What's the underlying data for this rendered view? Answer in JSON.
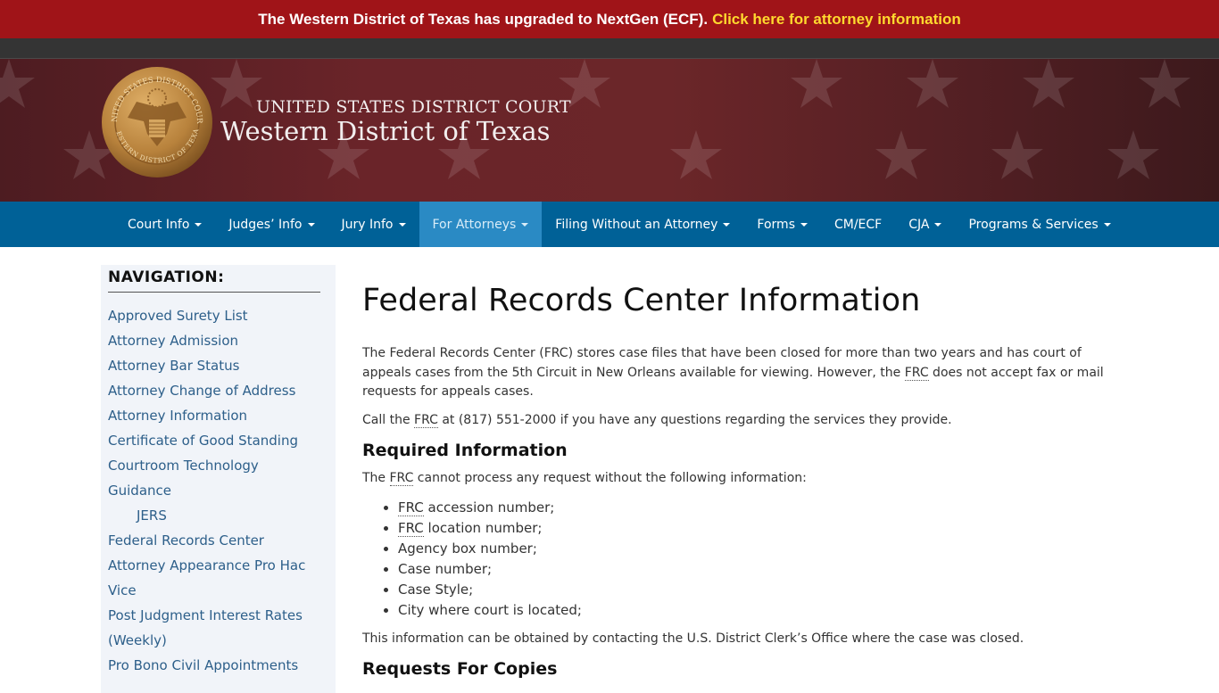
{
  "alert": {
    "text": "The Western District of Texas has upgraded to NextGen (ECF).",
    "link_text": "Click here for attorney information",
    "bg_color": "#a01418",
    "link_color": "#ffd92e"
  },
  "header": {
    "line1": "UNITED STATES DISTRICT COURT",
    "line2": "Western District of Texas",
    "seal_top_text": "UNITED STATES DISTRICT COURT",
    "seal_bottom_text": "WESTERN DISTRICT OF TEXAS"
  },
  "nav": {
    "items": [
      {
        "label": "Court Info",
        "dropdown": true
      },
      {
        "label": "Judges’ Info",
        "dropdown": true
      },
      {
        "label": "Jury Info",
        "dropdown": true
      },
      {
        "label": "For Attorneys",
        "dropdown": true,
        "active": true
      },
      {
        "label": "Filing Without an Attorney",
        "dropdown": true
      },
      {
        "label": "Forms",
        "dropdown": true
      },
      {
        "label": "CM/ECF",
        "dropdown": false
      },
      {
        "label": "CJA",
        "dropdown": true
      },
      {
        "label": "Programs & Services",
        "dropdown": true
      }
    ],
    "bg_color": "#006197",
    "active_color": "#2a8ac4"
  },
  "sidebar": {
    "title": "NAVIGATION:",
    "items": [
      {
        "label": "Approved Surety List"
      },
      {
        "label": "Attorney Admission"
      },
      {
        "label": "Attorney Bar Status"
      },
      {
        "label": "Attorney Change of Address"
      },
      {
        "label": "Attorney Information"
      },
      {
        "label": "Certificate of Good Standing"
      },
      {
        "label": "Courtroom Technology"
      },
      {
        "label": "Guidance"
      },
      {
        "label": "JERS",
        "sub": true
      },
      {
        "label": "Federal Records Center"
      },
      {
        "label": "Attorney Appearance Pro Hac"
      },
      {
        "label": "Vice"
      },
      {
        "label": "Post Judgment Interest Rates"
      },
      {
        "label": "(Weekly)"
      },
      {
        "label": "Pro Bono Civil Appointments"
      }
    ]
  },
  "main": {
    "title": "Federal Records Center Information",
    "abbr": "FRC",
    "abbr_title": "Federal Records Center",
    "p1_a": "The Federal Records Center (FRC) stores case files that have been closed for more than two years and has court of appeals cases from the 5th Circuit in New Orleans available for viewing. However, the ",
    "p1_b": " does not accept fax or mail requests for appeals cases.",
    "p2_a": "Call the ",
    "p2_b": " at (817) 551-2000 if you have any questions regarding the services they provide.",
    "section1_title": "Required Information",
    "p3_a": "The ",
    "p3_b": " cannot process any request without the following information:",
    "list": [
      {
        "abbr": "FRC",
        "text": " accession number;"
      },
      {
        "abbr": "FRC",
        "text": " location number;"
      },
      {
        "text": "Agency box number;"
      },
      {
        "text": "Case number;"
      },
      {
        "text": "Case Style;"
      },
      {
        "text": "City where court is located;"
      }
    ],
    "p4": "This information can be obtained by contacting the U.S. District Clerk’s Office where the case was closed.",
    "section2_title": "Requests For Copies"
  }
}
